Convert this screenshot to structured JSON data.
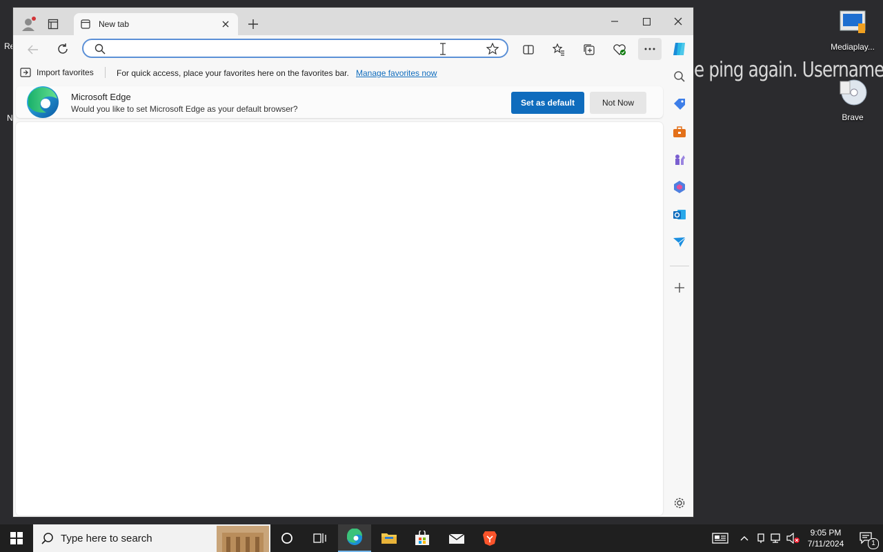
{
  "desktop": {
    "background_text": "e ping again. Username:",
    "icons": [
      {
        "label": "Mediaplay..."
      },
      {
        "label": "Brave"
      }
    ],
    "left_fragments": [
      "Re",
      "N"
    ]
  },
  "browser": {
    "tab": {
      "title": "New tab"
    },
    "address_bar": {
      "value": "",
      "placeholder": ""
    },
    "favorites_bar": {
      "import_label": "Import favorites",
      "message": "For quick access, place your favorites here on the favorites bar.",
      "link": "Manage favorites now"
    },
    "infobar": {
      "title": "Microsoft Edge",
      "message": "Would you like to set Microsoft Edge as your default browser?",
      "primary_button": "Set as default",
      "secondary_button": "Not Now"
    }
  },
  "taskbar": {
    "search_placeholder": "Type here to search",
    "time": "9:05 PM",
    "date": "7/11/2024",
    "notification_count": "1"
  },
  "colors": {
    "accent": "#0f6cbd",
    "address_border": "#5a8fd6",
    "taskbar": "#1f1f1f"
  }
}
